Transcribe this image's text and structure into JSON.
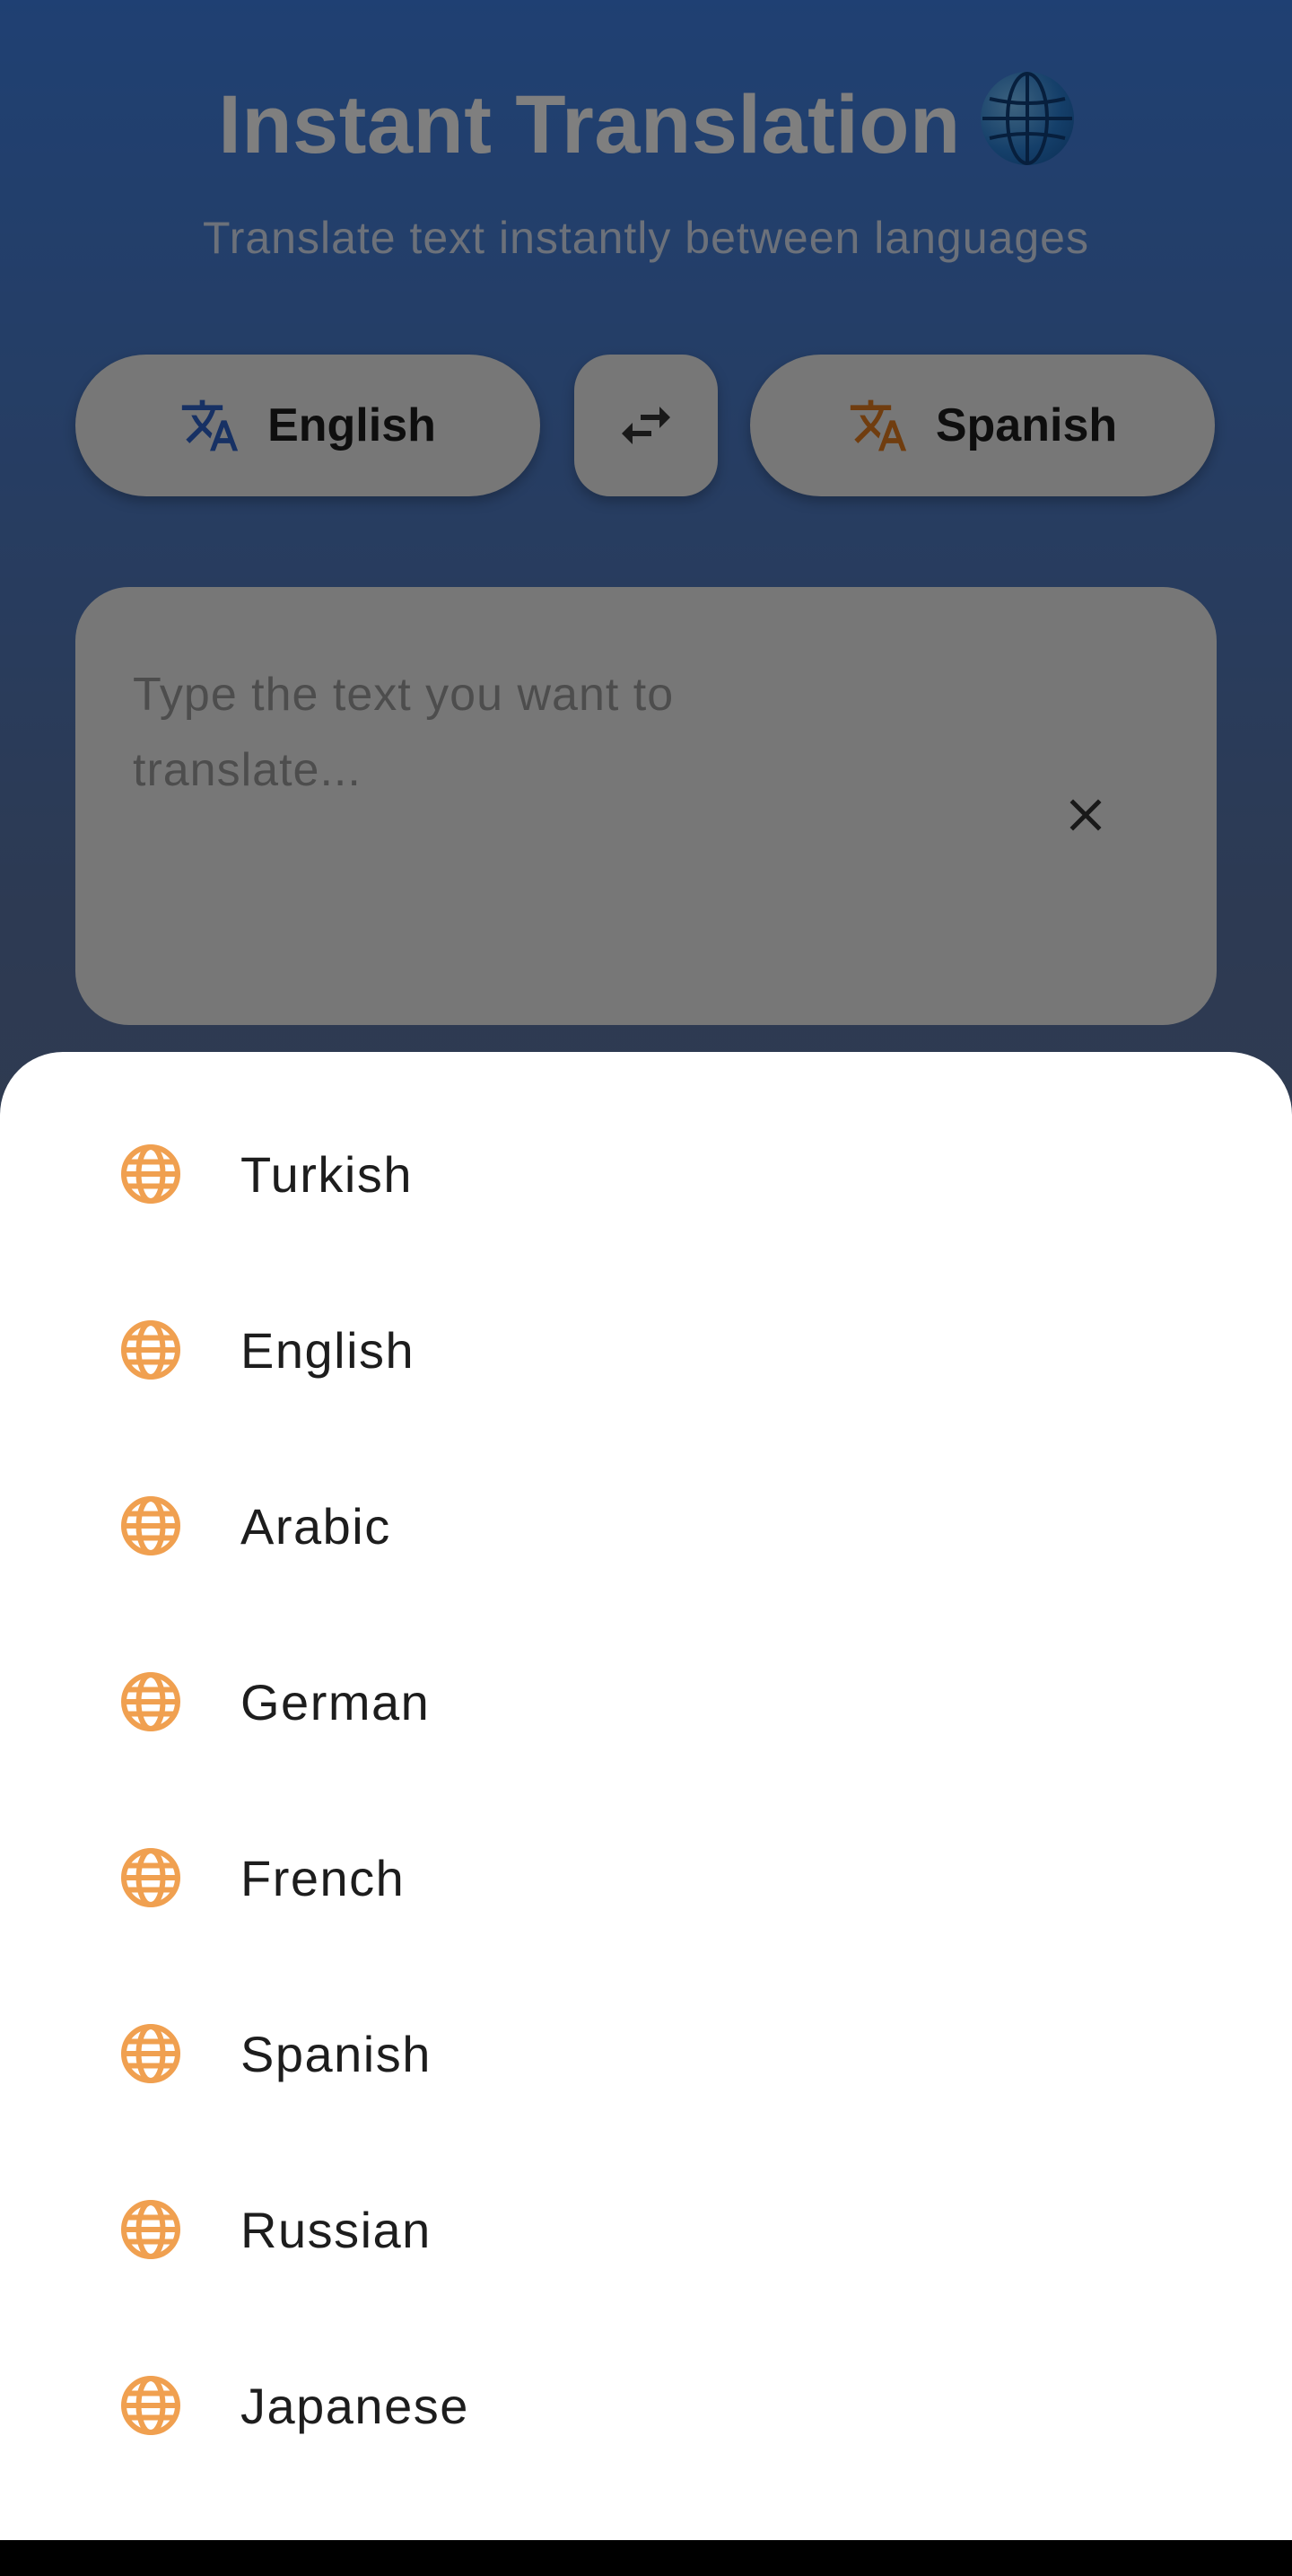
{
  "app": {
    "title": "Instant Translation",
    "title_emoji_icon": "globe-emoji-icon",
    "subtitle": "Translate text instantly between languages"
  },
  "language_bar": {
    "source_language": "English",
    "target_language": "Spanish",
    "swap_icon": "swap-arrows-icon",
    "translate_icon": "translate-icon"
  },
  "input": {
    "placeholder": "Type the text you want to translate...",
    "value": "",
    "clear_icon": "close-icon"
  },
  "language_sheet": {
    "item_icon": "globe-icon",
    "items": [
      {
        "label": "Turkish"
      },
      {
        "label": "English"
      },
      {
        "label": "Arabic"
      },
      {
        "label": "German"
      },
      {
        "label": "French"
      },
      {
        "label": "Spanish"
      },
      {
        "label": "Russian"
      },
      {
        "label": "Japanese"
      }
    ]
  },
  "colors": {
    "accent_orange": "#f0a050",
    "source_icon": "#2f63c9",
    "target_icon": "#e07a1f",
    "gradient_top": "#3f81e6",
    "gradient_bottom": "#7c7c84"
  }
}
